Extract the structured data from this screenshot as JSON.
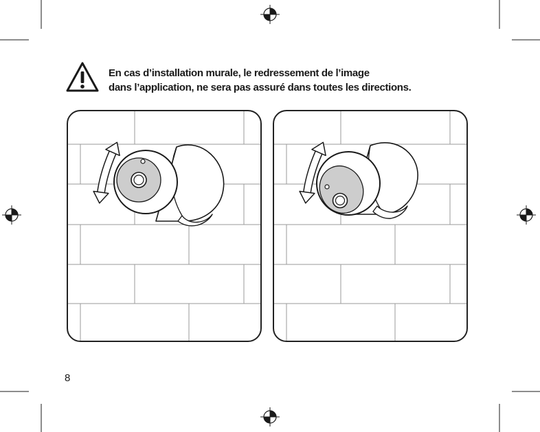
{
  "warning": {
    "icon": "warning-triangle-icon",
    "line1": "En cas d’installation murale, le redressement de l’image",
    "line2": "dans l’application, ne sera pas assuré dans toutes les directions."
  },
  "illustrations": [
    {
      "icon": "camera-wall-mount-upright-illustration"
    },
    {
      "icon": "camera-wall-mount-rotated-illustration"
    }
  ],
  "icons": {
    "registration_mark": "registration-mark-icon",
    "rotation_arrow": "rotate-arrow-icon",
    "crop_mark": "crop-mark"
  },
  "colors": {
    "ink": "#1a1a1a",
    "lens_face": "#cdcdcd",
    "page": "#ffffff"
  },
  "page_number": "8"
}
